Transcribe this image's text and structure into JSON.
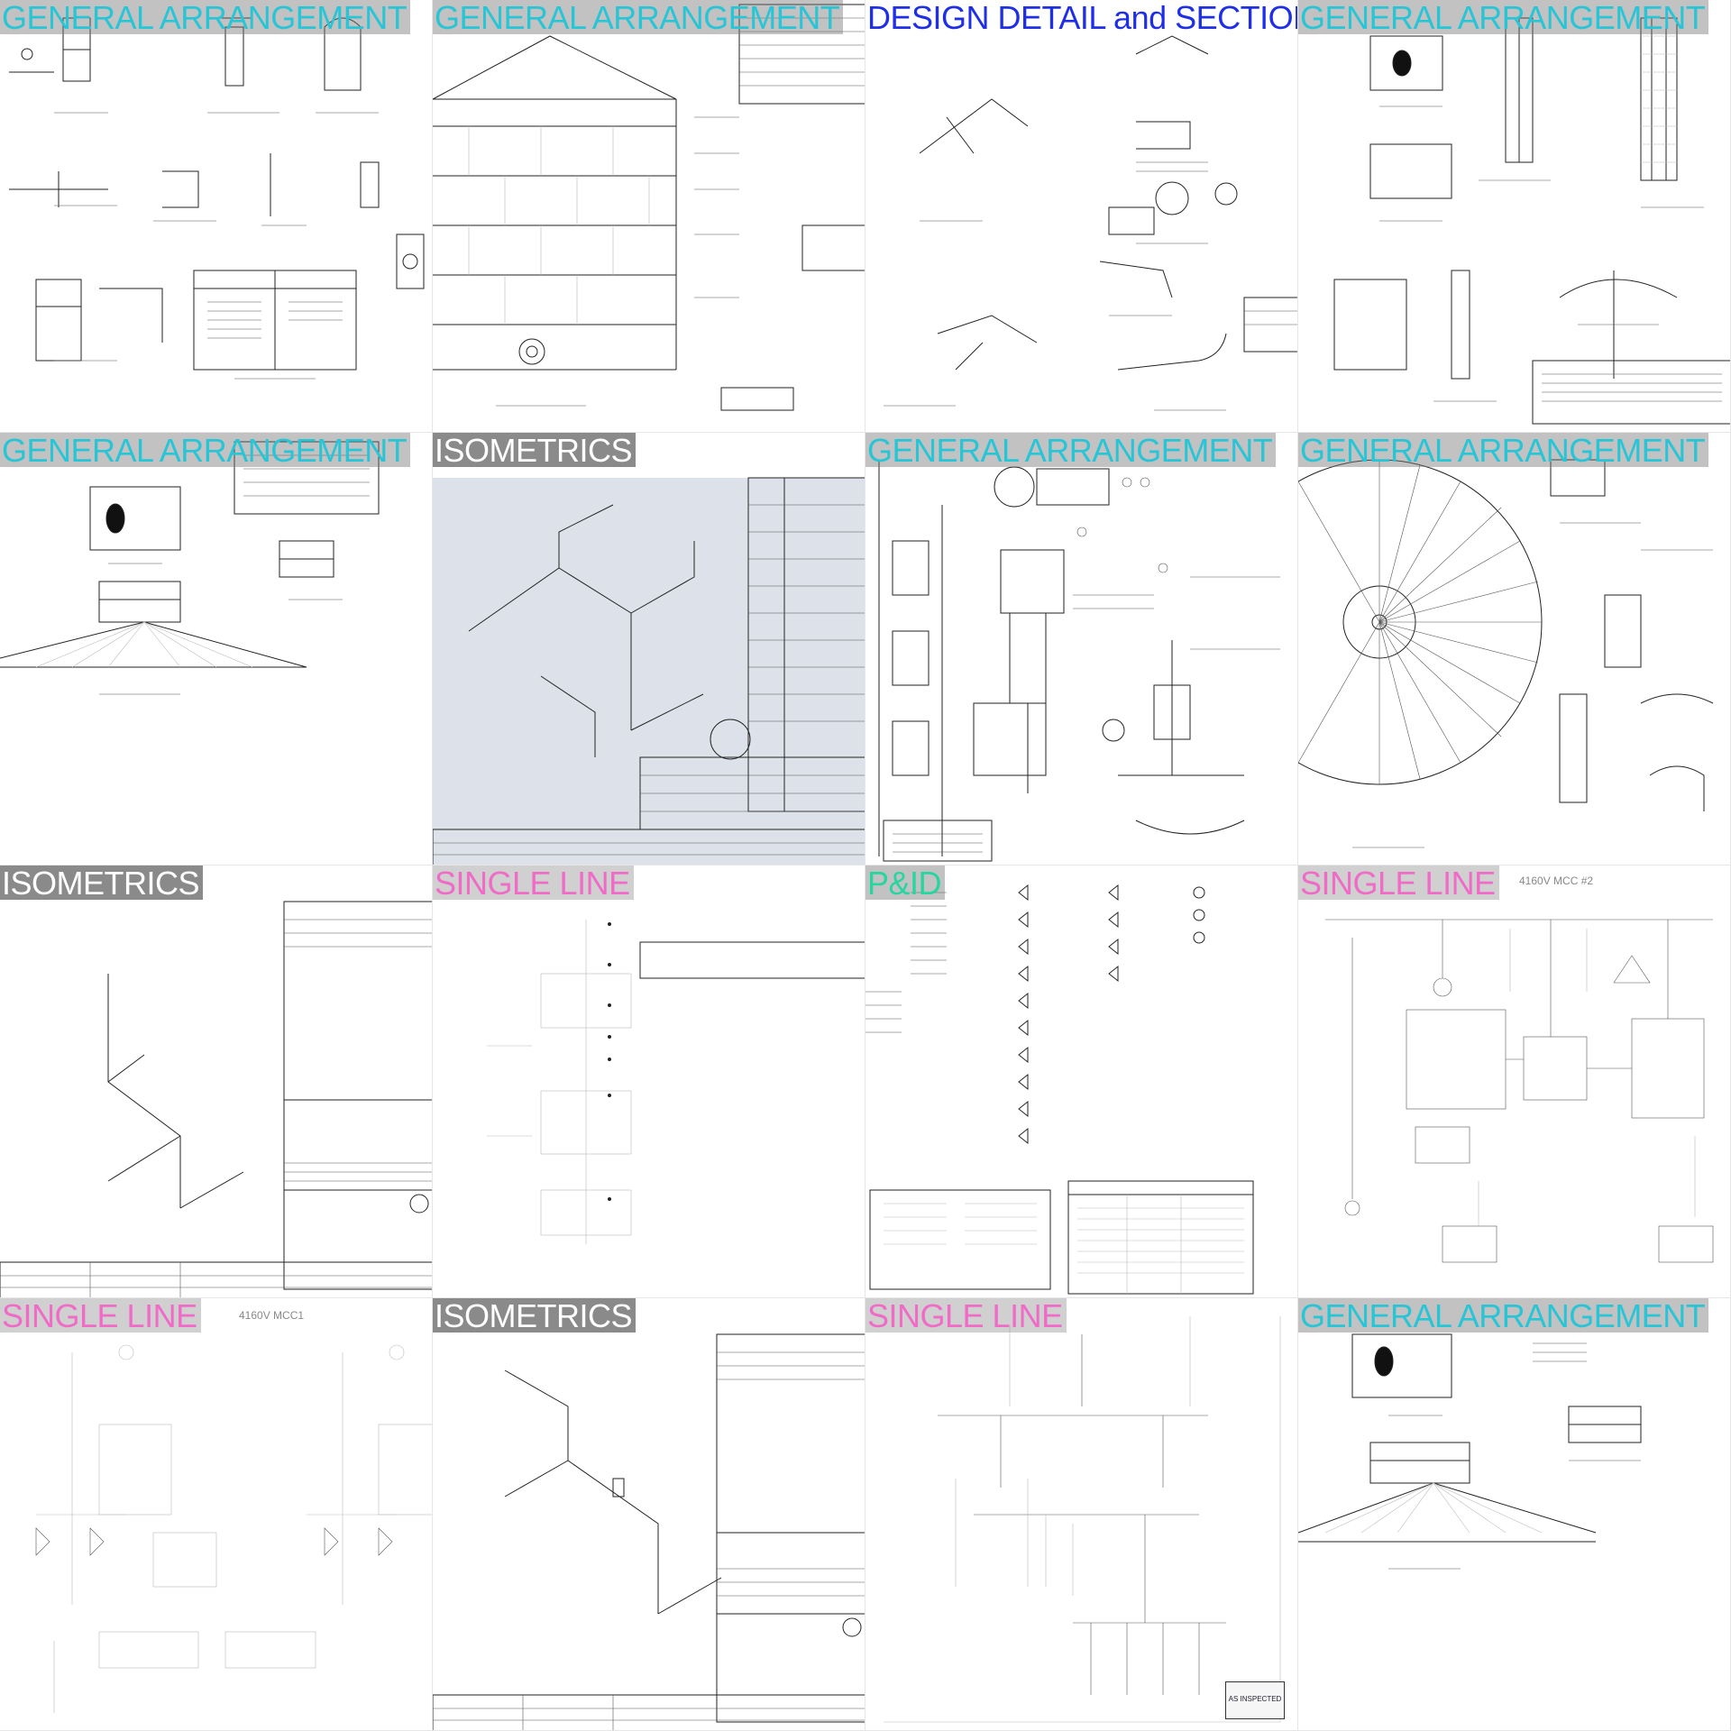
{
  "tiles": [
    {
      "label": "GENERAL ARRANGEMENT",
      "style": "teal"
    },
    {
      "label": "GENERAL ARRANGEMENT",
      "style": "teal"
    },
    {
      "label": "DESIGN DETAIL and SECTION",
      "style": "blue"
    },
    {
      "label": "GENERAL ARRANGEMENT",
      "style": "teal"
    },
    {
      "label": "GENERAL ARRANGEMENT",
      "style": "teal"
    },
    {
      "label": "ISOMETRICS",
      "style": "white"
    },
    {
      "label": "GENERAL ARRANGEMENT",
      "style": "teal"
    },
    {
      "label": "GENERAL ARRANGEMENT",
      "style": "teal"
    },
    {
      "label": "ISOMETRICS",
      "style": "white"
    },
    {
      "label": "SINGLE LINE",
      "style": "pink"
    },
    {
      "label": "P&ID",
      "style": "green"
    },
    {
      "label": "SINGLE LINE",
      "style": "pink",
      "subtitle": "4160V MCC #2"
    },
    {
      "label": "SINGLE LINE",
      "style": "pink",
      "subtitle": "4160V MCC1"
    },
    {
      "label": "ISOMETRICS",
      "style": "white"
    },
    {
      "label": "SINGLE LINE",
      "style": "pink",
      "stamp": "AS INSPECTED"
    },
    {
      "label": "GENERAL ARRANGEMENT",
      "style": "teal"
    }
  ],
  "colors": {
    "teal": "#27c5d6",
    "pink": "#f06bc8",
    "blue": "#1f2fe6",
    "green": "#25d6a0",
    "white_on_gray": "#8a8a8a"
  }
}
